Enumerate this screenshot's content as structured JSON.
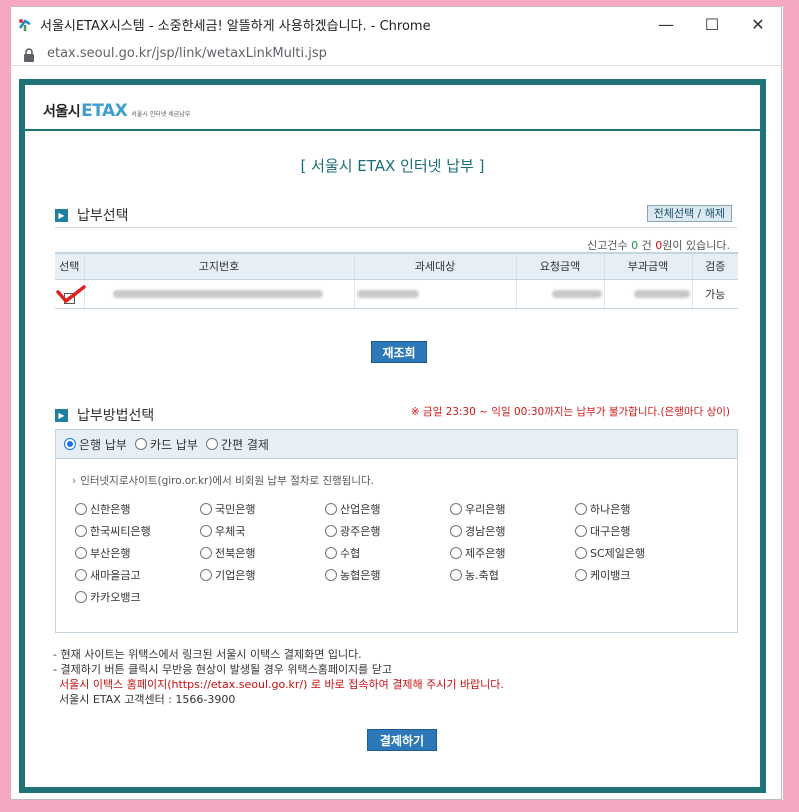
{
  "browser": {
    "title": "서울시ETAX시스템 - 소중한세금! 알뜰하게 사용하겠습니다. - Chrome",
    "url": "etax.seoul.go.kr/jsp/link/wetaxLinkMulti.jsp",
    "controls": {
      "minimize": "—",
      "maximize": "☐",
      "close": "✕"
    }
  },
  "logo": {
    "main": "서울시",
    "etax": "ETAX",
    "sub": "서울시 인터넷 세금납부"
  },
  "page_title": "[ 서울시 ETAX 인터넷 납부 ]",
  "section_select": {
    "title": "납부선택",
    "select_all": "전체선택 / 해제",
    "count_prefix": "신고건수",
    "count": "0",
    "count_mid": "건",
    "amount": "0",
    "count_suffix": "원이 있습니다.",
    "columns": [
      "선택",
      "고지번호",
      "과세대상",
      "요청금액",
      "부과금액",
      "검증"
    ],
    "row": {
      "status": "가능"
    },
    "refresh": "재조회"
  },
  "section_method": {
    "title": "납부방법선택",
    "warning": "※ 금일 23:30 ~ 익일 00:30까지는 납부가 불가합니다.(은행마다 상이)",
    "options": [
      "은행 납부",
      "카드 납부",
      "간편 결제"
    ],
    "note": "인터넷지로사이트(giro.or.kr)에서 비회원 납부 절차로 진행됩니다.",
    "banks": [
      "신한은행",
      "국민은행",
      "산업은행",
      "우리은행",
      "하나은행",
      "한국씨티은행",
      "우체국",
      "광주은행",
      "경남은행",
      "대구은행",
      "부산은행",
      "전북은행",
      "수협",
      "제주은행",
      "SC제일은행",
      "새마을금고",
      "기업은행",
      "농협은행",
      "농.축협",
      "케이뱅크",
      "카카오뱅크"
    ]
  },
  "footer": {
    "line1": "- 현재 사이트는 위택스에서 링크된 서울시 이택스 결제화면 입니다.",
    "line2": "- 결제하기 버튼 클릭시 무반응 현상이 발생될 경우 위택스홈페이지를 닫고",
    "line3": "서울시 이택스 홈페이지(https://etax.seoul.go.kr/) 로 바로 접속하여 결제해 주시기 바랍니다.",
    "line4": "서울시 ETAX 고객센터 : 1566-3900",
    "pay_button": "결제하기"
  },
  "colors": {
    "teal_border": "#1f7276",
    "blue_button": "#2d78b8",
    "annotation": "#e02020",
    "frame": "#f5a8c4"
  }
}
